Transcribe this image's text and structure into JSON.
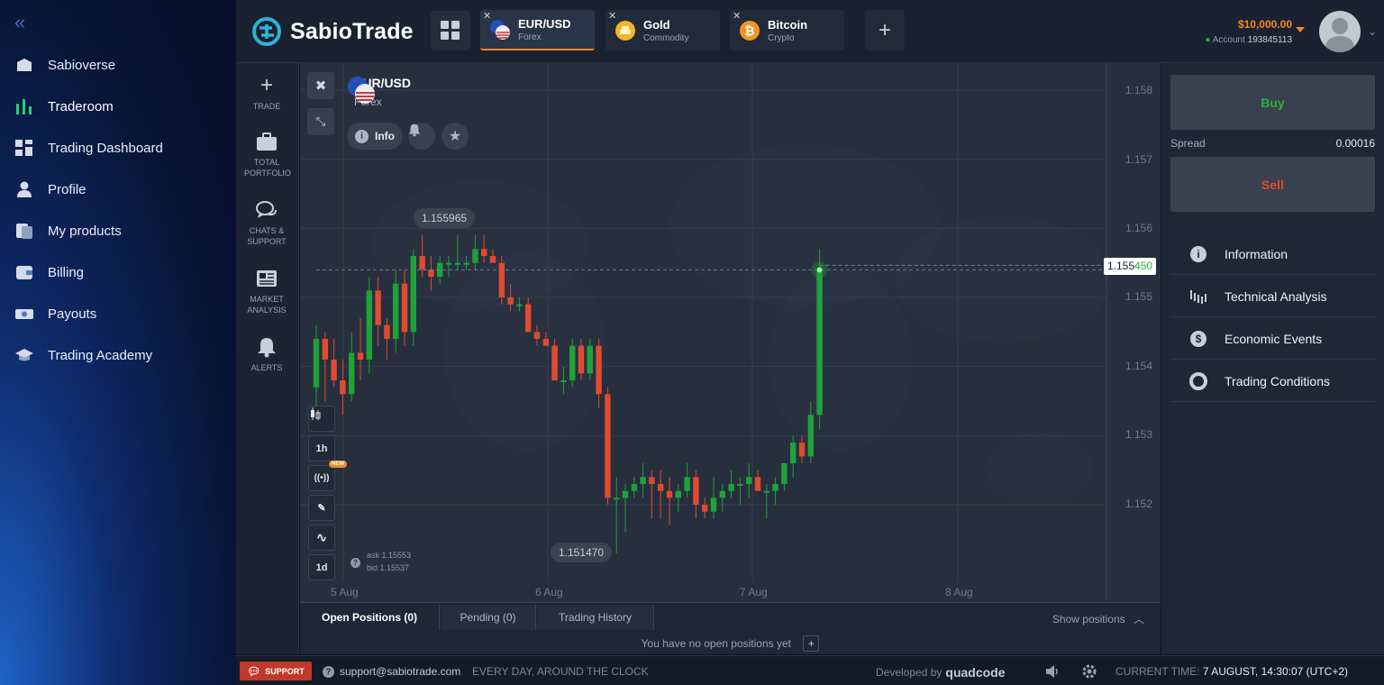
{
  "nav": {
    "items": [
      {
        "label": "Sabioverse"
      },
      {
        "label": "Traderoom"
      },
      {
        "label": "Trading Dashboard"
      },
      {
        "label": "Profile"
      },
      {
        "label": "My products"
      },
      {
        "label": "Billing"
      },
      {
        "label": "Payouts"
      },
      {
        "label": "Trading Academy"
      }
    ]
  },
  "header": {
    "logo": "SabioTrade",
    "tabs": [
      {
        "name": "EUR/USD",
        "type": "Forex"
      },
      {
        "name": "Gold",
        "type": "Commodity"
      },
      {
        "name": "Bitcoin",
        "type": "Crypto"
      }
    ],
    "balance": "$10,000.00",
    "account_label": "Account",
    "account_number": "193845113"
  },
  "tools": [
    {
      "label": "TRADE"
    },
    {
      "label": "TOTAL PORTFOLIO"
    },
    {
      "label": "CHATS & SUPPORT"
    },
    {
      "label": "MARKET ANALYSIS"
    },
    {
      "label": "ALERTS"
    }
  ],
  "chart": {
    "asset": "EUR/USD",
    "asset_type": "Forex",
    "info_label": "Info",
    "timeframes": {
      "candle": "1h",
      "period": "1d",
      "new_badge": "NEW"
    },
    "high_label": "1.155965",
    "low_label": "1.151470",
    "price_main": "1.155",
    "price_accent": "450",
    "ask": "ask 1.15553",
    "bid": "bid 1.15537",
    "y_ticks": [
      "1.158",
      "1.157",
      "1.156",
      "1.155",
      "1.154",
      "1.153",
      "1.152"
    ],
    "x_ticks": [
      "5 Aug",
      "6 Aug",
      "7 Aug",
      "8 Aug"
    ],
    "colors": {
      "up": "#1fa23a",
      "down": "#e04b2f"
    }
  },
  "chart_data": {
    "type": "candlestick",
    "ylim": [
      1.1512,
      1.1582
    ],
    "candles": [
      [
        1.1537,
        1.1546,
        1.1534,
        1.1544
      ],
      [
        1.1544,
        1.1545,
        1.1535,
        1.1541
      ],
      [
        1.1541,
        1.1544,
        1.1537,
        1.1538
      ],
      [
        1.1538,
        1.1541,
        1.1533,
        1.1536
      ],
      [
        1.1536,
        1.1545,
        1.1535,
        1.1542
      ],
      [
        1.1542,
        1.1547,
        1.1538,
        1.1541
      ],
      [
        1.1541,
        1.1553,
        1.1539,
        1.1551
      ],
      [
        1.1551,
        1.1553,
        1.1543,
        1.1546
      ],
      [
        1.1546,
        1.1547,
        1.1541,
        1.1544
      ],
      [
        1.1544,
        1.1554,
        1.1542,
        1.1552
      ],
      [
        1.1552,
        1.1554,
        1.1543,
        1.1545
      ],
      [
        1.1545,
        1.1557,
        1.1543,
        1.1556
      ],
      [
        1.1556,
        1.1559,
        1.1553,
        1.1554
      ],
      [
        1.1554,
        1.1556,
        1.1551,
        1.1553
      ],
      [
        1.1553,
        1.1556,
        1.1552,
        1.1555
      ],
      [
        1.1555,
        1.1556,
        1.1553,
        1.1555
      ],
      [
        1.1555,
        1.1559,
        1.1554,
        1.1555
      ],
      [
        1.1555,
        1.1556,
        1.1554,
        1.1555
      ],
      [
        1.1555,
        1.1559,
        1.1554,
        1.1557
      ],
      [
        1.1557,
        1.1559,
        1.1555,
        1.1556
      ],
      [
        1.1556,
        1.1557,
        1.1555,
        1.1555
      ],
      [
        1.1555,
        1.1556,
        1.1549,
        1.155
      ],
      [
        1.155,
        1.1552,
        1.1548,
        1.1549
      ],
      [
        1.1549,
        1.155,
        1.1548,
        1.1549
      ],
      [
        1.1549,
        1.155,
        1.1545,
        1.1545
      ],
      [
        1.1545,
        1.1546,
        1.1543,
        1.1544
      ],
      [
        1.1544,
        1.1545,
        1.1543,
        1.1543
      ],
      [
        1.1543,
        1.1544,
        1.1538,
        1.1538
      ],
      [
        1.1538,
        1.154,
        1.1536,
        1.1538
      ],
      [
        1.1538,
        1.1544,
        1.1537,
        1.1543
      ],
      [
        1.1543,
        1.1544,
        1.1538,
        1.1539
      ],
      [
        1.1539,
        1.1544,
        1.1538,
        1.1543
      ],
      [
        1.1543,
        1.1544,
        1.1534,
        1.1536
      ],
      [
        1.1536,
        1.1537,
        1.152,
        1.1521
      ],
      [
        1.1521,
        1.1524,
        1.1513,
        1.1521
      ],
      [
        1.1521,
        1.1523,
        1.1516,
        1.1522
      ],
      [
        1.1522,
        1.1524,
        1.1521,
        1.1523
      ],
      [
        1.1523,
        1.1526,
        1.1521,
        1.1524
      ],
      [
        1.1524,
        1.1525,
        1.1518,
        1.1523
      ],
      [
        1.1523,
        1.1525,
        1.1518,
        1.1522
      ],
      [
        1.1522,
        1.1524,
        1.1517,
        1.1521
      ],
      [
        1.1521,
        1.1523,
        1.1519,
        1.1522
      ],
      [
        1.1522,
        1.1526,
        1.1521,
        1.1524
      ],
      [
        1.1524,
        1.1525,
        1.1518,
        1.152
      ],
      [
        1.152,
        1.1521,
        1.1518,
        1.1519
      ],
      [
        1.1519,
        1.1524,
        1.1518,
        1.1521
      ],
      [
        1.1521,
        1.1523,
        1.1519,
        1.1522
      ],
      [
        1.1522,
        1.1525,
        1.1521,
        1.1523
      ],
      [
        1.1523,
        1.1524,
        1.152,
        1.1523
      ],
      [
        1.1523,
        1.1526,
        1.1521,
        1.1524
      ],
      [
        1.1524,
        1.1525,
        1.1522,
        1.1522
      ],
      [
        1.1522,
        1.1523,
        1.1518,
        1.1522
      ],
      [
        1.1522,
        1.1524,
        1.152,
        1.1523
      ],
      [
        1.1523,
        1.1526,
        1.1522,
        1.1526
      ],
      [
        1.1526,
        1.153,
        1.1524,
        1.1529
      ],
      [
        1.1529,
        1.153,
        1.1526,
        1.1527
      ],
      [
        1.1527,
        1.1535,
        1.1526,
        1.1533
      ],
      [
        1.1533,
        1.1557,
        1.1531,
        1.1554
      ]
    ]
  },
  "right": {
    "buy": "Buy",
    "sell": "Sell",
    "spread_label": "Spread",
    "spread_value": "0.00016",
    "info_items": [
      {
        "label": "Information"
      },
      {
        "label": "Technical Analysis"
      },
      {
        "label": "Economic Events"
      },
      {
        "label": "Trading Conditions"
      }
    ]
  },
  "bottom": {
    "tabs": [
      {
        "label": "Open Positions (0)"
      },
      {
        "label": "Pending (0)"
      },
      {
        "label": "Trading History"
      }
    ],
    "show_positions": "Show positions",
    "empty": "You have no open positions yet"
  },
  "footer": {
    "support": "SUPPORT",
    "email": "support@sabiotrade.com",
    "hours": "EVERY DAY, AROUND THE CLOCK",
    "developed_by": "Developed by",
    "developer": "quadcode",
    "time_label": "CURRENT TIME:",
    "time_value": "7 AUGUST, 14:30:07",
    "tz": "(UTC+2)"
  }
}
